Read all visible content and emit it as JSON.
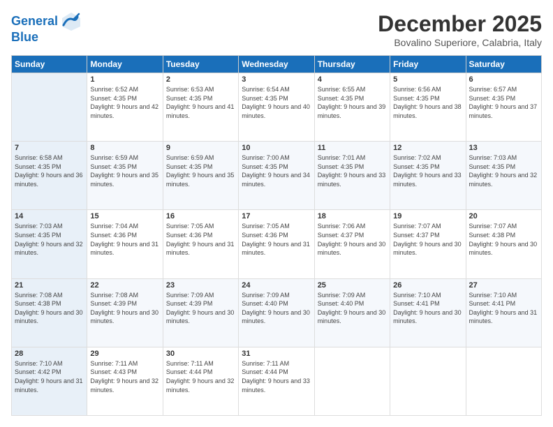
{
  "header": {
    "logo_line1": "General",
    "logo_line2": "Blue",
    "month_title": "December 2025",
    "location": "Bovalino Superiore, Calabria, Italy"
  },
  "days_of_week": [
    "Sunday",
    "Monday",
    "Tuesday",
    "Wednesday",
    "Thursday",
    "Friday",
    "Saturday"
  ],
  "weeks": [
    [
      {
        "day": "",
        "sunrise": "",
        "sunset": "",
        "daylight": ""
      },
      {
        "day": "1",
        "sunrise": "Sunrise: 6:52 AM",
        "sunset": "Sunset: 4:35 PM",
        "daylight": "Daylight: 9 hours and 42 minutes."
      },
      {
        "day": "2",
        "sunrise": "Sunrise: 6:53 AM",
        "sunset": "Sunset: 4:35 PM",
        "daylight": "Daylight: 9 hours and 41 minutes."
      },
      {
        "day": "3",
        "sunrise": "Sunrise: 6:54 AM",
        "sunset": "Sunset: 4:35 PM",
        "daylight": "Daylight: 9 hours and 40 minutes."
      },
      {
        "day": "4",
        "sunrise": "Sunrise: 6:55 AM",
        "sunset": "Sunset: 4:35 PM",
        "daylight": "Daylight: 9 hours and 39 minutes."
      },
      {
        "day": "5",
        "sunrise": "Sunrise: 6:56 AM",
        "sunset": "Sunset: 4:35 PM",
        "daylight": "Daylight: 9 hours and 38 minutes."
      },
      {
        "day": "6",
        "sunrise": "Sunrise: 6:57 AM",
        "sunset": "Sunset: 4:35 PM",
        "daylight": "Daylight: 9 hours and 37 minutes."
      }
    ],
    [
      {
        "day": "7",
        "sunrise": "Sunrise: 6:58 AM",
        "sunset": "Sunset: 4:35 PM",
        "daylight": "Daylight: 9 hours and 36 minutes."
      },
      {
        "day": "8",
        "sunrise": "Sunrise: 6:59 AM",
        "sunset": "Sunset: 4:35 PM",
        "daylight": "Daylight: 9 hours and 35 minutes."
      },
      {
        "day": "9",
        "sunrise": "Sunrise: 6:59 AM",
        "sunset": "Sunset: 4:35 PM",
        "daylight": "Daylight: 9 hours and 35 minutes."
      },
      {
        "day": "10",
        "sunrise": "Sunrise: 7:00 AM",
        "sunset": "Sunset: 4:35 PM",
        "daylight": "Daylight: 9 hours and 34 minutes."
      },
      {
        "day": "11",
        "sunrise": "Sunrise: 7:01 AM",
        "sunset": "Sunset: 4:35 PM",
        "daylight": "Daylight: 9 hours and 33 minutes."
      },
      {
        "day": "12",
        "sunrise": "Sunrise: 7:02 AM",
        "sunset": "Sunset: 4:35 PM",
        "daylight": "Daylight: 9 hours and 33 minutes."
      },
      {
        "day": "13",
        "sunrise": "Sunrise: 7:03 AM",
        "sunset": "Sunset: 4:35 PM",
        "daylight": "Daylight: 9 hours and 32 minutes."
      }
    ],
    [
      {
        "day": "14",
        "sunrise": "Sunrise: 7:03 AM",
        "sunset": "Sunset: 4:35 PM",
        "daylight": "Daylight: 9 hours and 32 minutes."
      },
      {
        "day": "15",
        "sunrise": "Sunrise: 7:04 AM",
        "sunset": "Sunset: 4:36 PM",
        "daylight": "Daylight: 9 hours and 31 minutes."
      },
      {
        "day": "16",
        "sunrise": "Sunrise: 7:05 AM",
        "sunset": "Sunset: 4:36 PM",
        "daylight": "Daylight: 9 hours and 31 minutes."
      },
      {
        "day": "17",
        "sunrise": "Sunrise: 7:05 AM",
        "sunset": "Sunset: 4:36 PM",
        "daylight": "Daylight: 9 hours and 31 minutes."
      },
      {
        "day": "18",
        "sunrise": "Sunrise: 7:06 AM",
        "sunset": "Sunset: 4:37 PM",
        "daylight": "Daylight: 9 hours and 30 minutes."
      },
      {
        "day": "19",
        "sunrise": "Sunrise: 7:07 AM",
        "sunset": "Sunset: 4:37 PM",
        "daylight": "Daylight: 9 hours and 30 minutes."
      },
      {
        "day": "20",
        "sunrise": "Sunrise: 7:07 AM",
        "sunset": "Sunset: 4:38 PM",
        "daylight": "Daylight: 9 hours and 30 minutes."
      }
    ],
    [
      {
        "day": "21",
        "sunrise": "Sunrise: 7:08 AM",
        "sunset": "Sunset: 4:38 PM",
        "daylight": "Daylight: 9 hours and 30 minutes."
      },
      {
        "day": "22",
        "sunrise": "Sunrise: 7:08 AM",
        "sunset": "Sunset: 4:39 PM",
        "daylight": "Daylight: 9 hours and 30 minutes."
      },
      {
        "day": "23",
        "sunrise": "Sunrise: 7:09 AM",
        "sunset": "Sunset: 4:39 PM",
        "daylight": "Daylight: 9 hours and 30 minutes."
      },
      {
        "day": "24",
        "sunrise": "Sunrise: 7:09 AM",
        "sunset": "Sunset: 4:40 PM",
        "daylight": "Daylight: 9 hours and 30 minutes."
      },
      {
        "day": "25",
        "sunrise": "Sunrise: 7:09 AM",
        "sunset": "Sunset: 4:40 PM",
        "daylight": "Daylight: 9 hours and 30 minutes."
      },
      {
        "day": "26",
        "sunrise": "Sunrise: 7:10 AM",
        "sunset": "Sunset: 4:41 PM",
        "daylight": "Daylight: 9 hours and 30 minutes."
      },
      {
        "day": "27",
        "sunrise": "Sunrise: 7:10 AM",
        "sunset": "Sunset: 4:41 PM",
        "daylight": "Daylight: 9 hours and 31 minutes."
      }
    ],
    [
      {
        "day": "28",
        "sunrise": "Sunrise: 7:10 AM",
        "sunset": "Sunset: 4:42 PM",
        "daylight": "Daylight: 9 hours and 31 minutes."
      },
      {
        "day": "29",
        "sunrise": "Sunrise: 7:11 AM",
        "sunset": "Sunset: 4:43 PM",
        "daylight": "Daylight: 9 hours and 32 minutes."
      },
      {
        "day": "30",
        "sunrise": "Sunrise: 7:11 AM",
        "sunset": "Sunset: 4:44 PM",
        "daylight": "Daylight: 9 hours and 32 minutes."
      },
      {
        "day": "31",
        "sunrise": "Sunrise: 7:11 AM",
        "sunset": "Sunset: 4:44 PM",
        "daylight": "Daylight: 9 hours and 33 minutes."
      },
      {
        "day": "",
        "sunrise": "",
        "sunset": "",
        "daylight": ""
      },
      {
        "day": "",
        "sunrise": "",
        "sunset": "",
        "daylight": ""
      },
      {
        "day": "",
        "sunrise": "",
        "sunset": "",
        "daylight": ""
      }
    ]
  ]
}
